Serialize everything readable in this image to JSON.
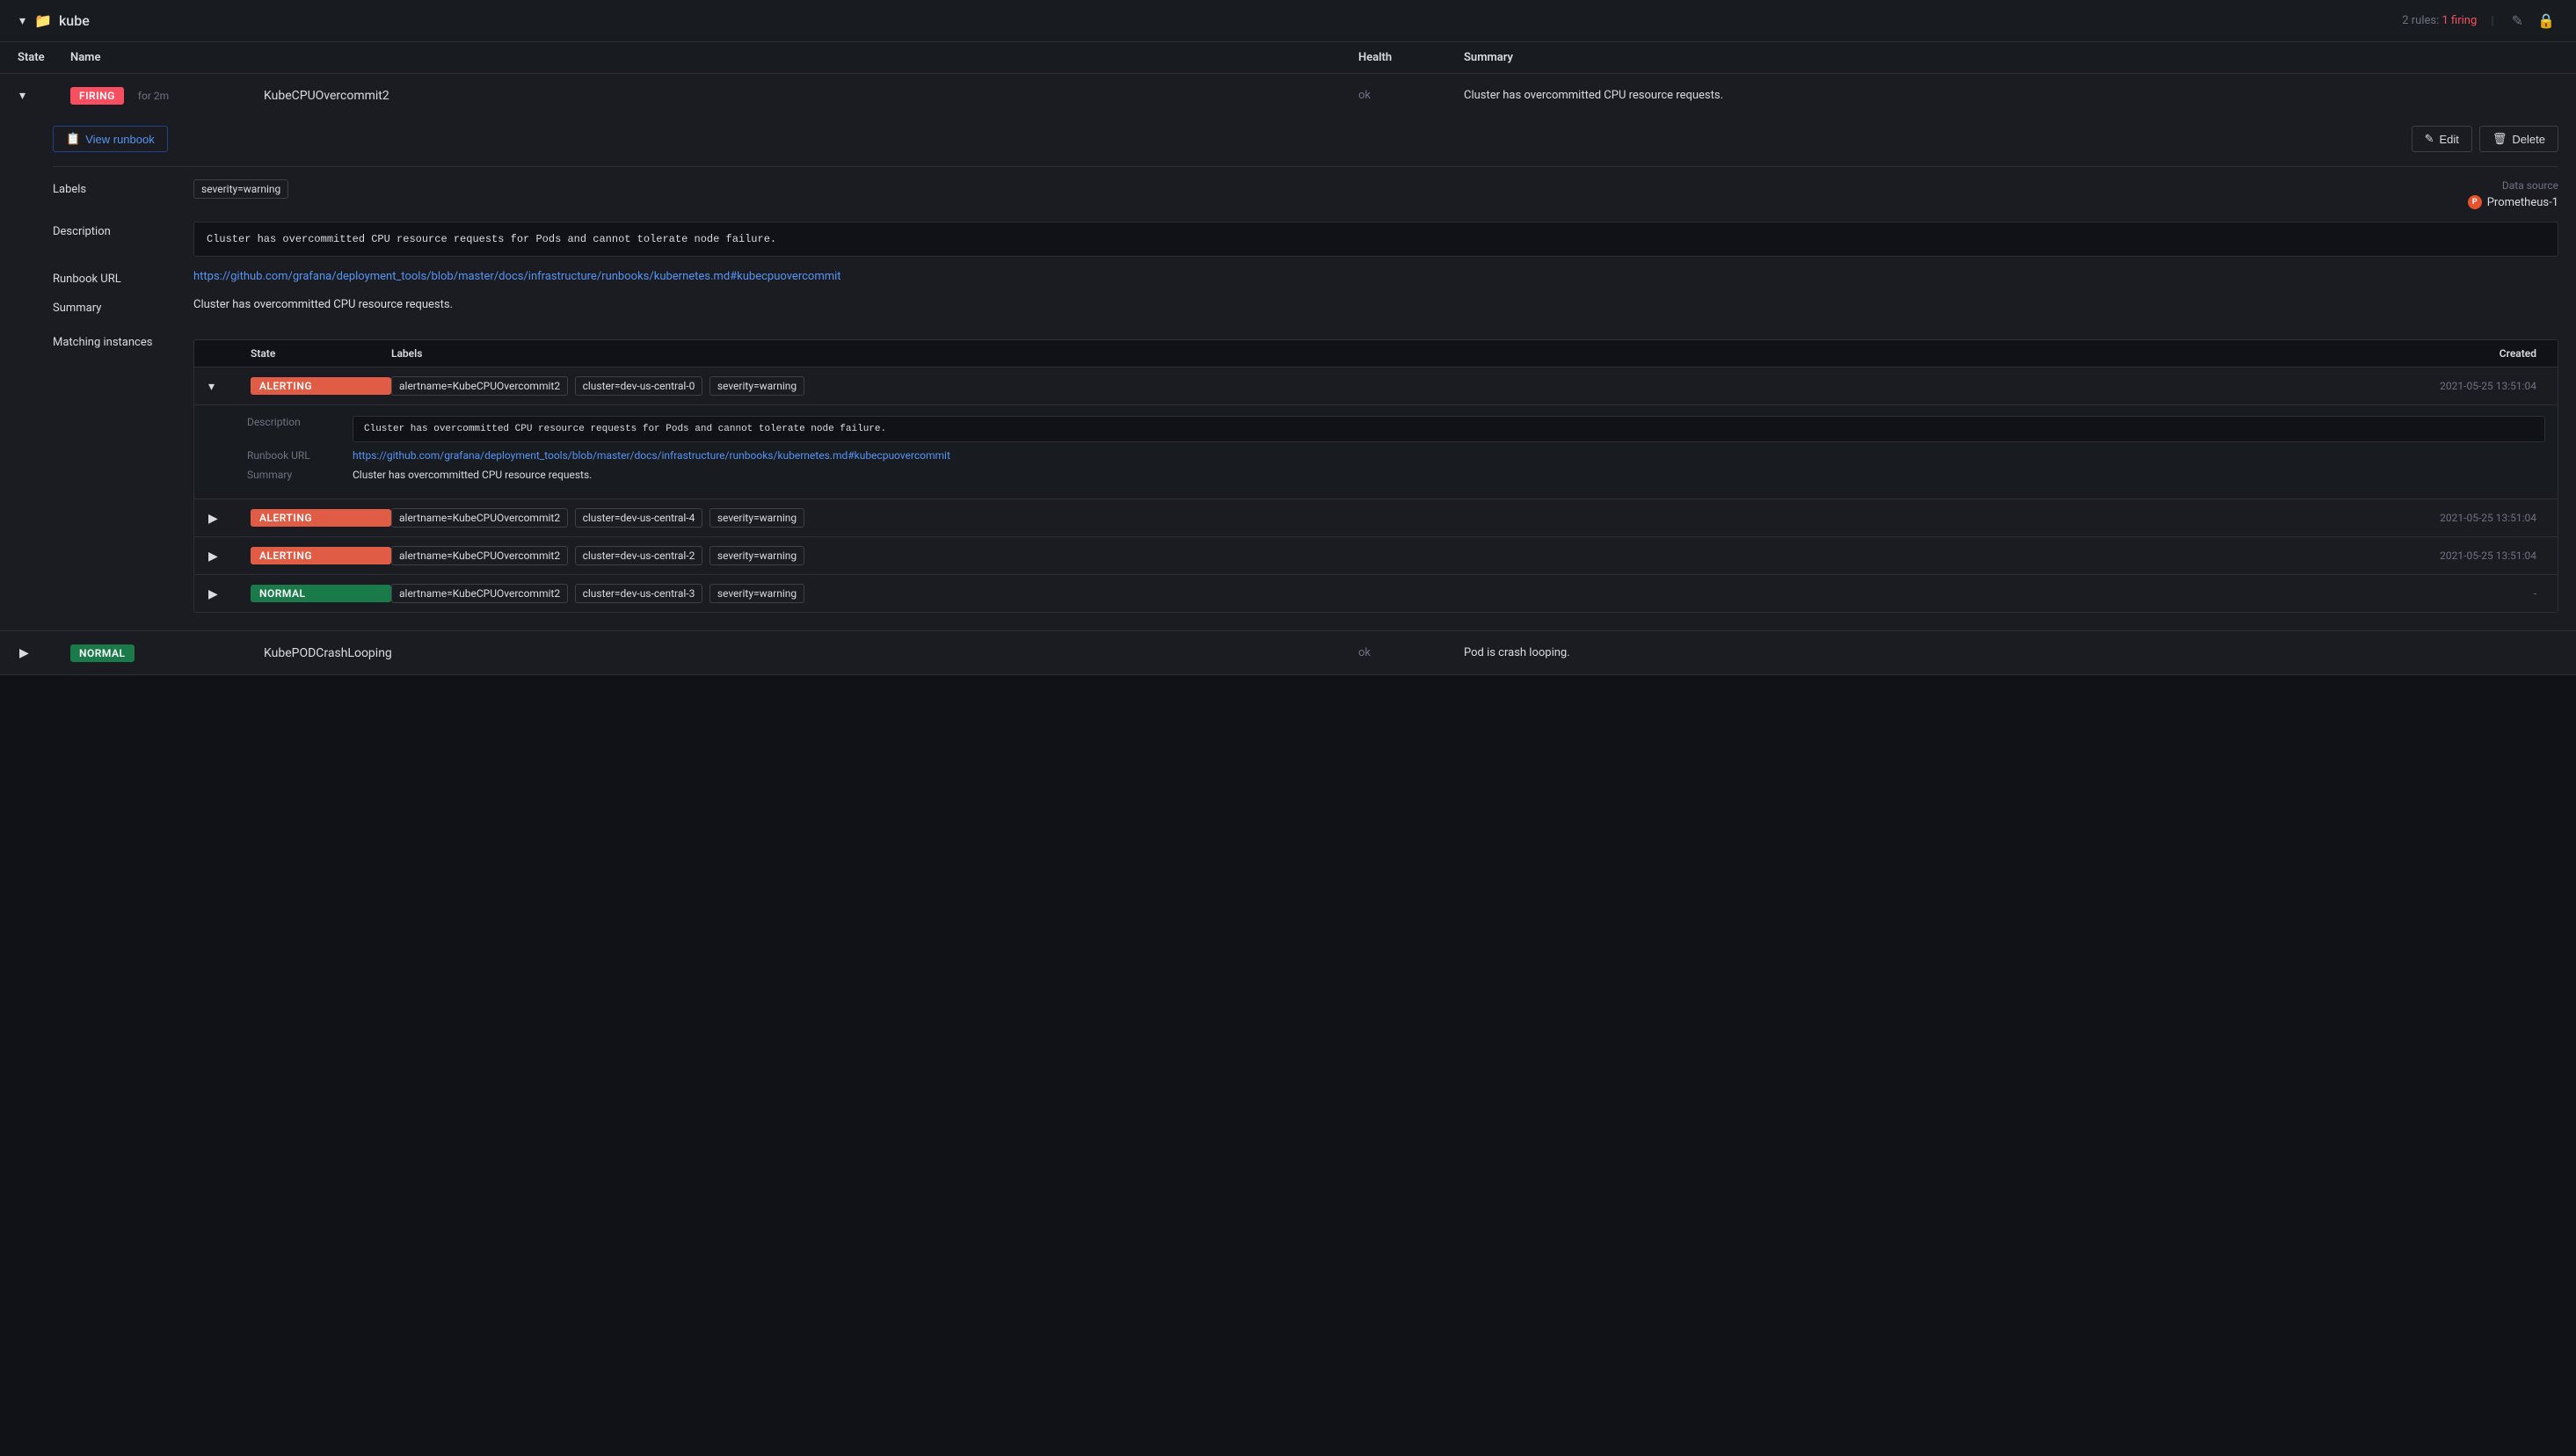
{
  "topbar": {
    "chevron": "▾",
    "folder_icon": "📁",
    "title": "kube",
    "rules_text": "2 rules:",
    "firing_count": "1 firing",
    "divider": "|",
    "edit_icon": "✎",
    "lock_icon": "🔒"
  },
  "table": {
    "headers": {
      "state": "State",
      "name": "Name",
      "health": "Health",
      "summary": "Summary"
    }
  },
  "rule1": {
    "state": "Firing",
    "state_type": "firing",
    "for_duration": "for 2m",
    "name": "KubeCPUOvercommit2",
    "health": "ok",
    "summary": "Cluster has overcommitted CPU resource requests.",
    "view_runbook_label": "View runbook",
    "edit_label": "Edit",
    "delete_label": "Delete",
    "labels_label": "Labels",
    "labels": [
      "severity=warning"
    ],
    "data_source_label": "Data source",
    "data_source_name": "Prometheus-1",
    "description_label": "Description",
    "description": "Cluster has overcommitted CPU resource requests for Pods and cannot tolerate node failure.",
    "runbook_url_label": "Runbook URL",
    "runbook_url": "https://github.com/grafana/deployment_tools/blob/master/docs/infrastructure/runbooks/kubernetes.md#kubecpuovercommit",
    "summary_label": "Summary",
    "summary_detail": "Cluster has overcommitted CPU resource requests.",
    "matching_instances_label": "Matching instances",
    "instances_headers": {
      "state": "State",
      "labels": "Labels",
      "created": "Created"
    },
    "instances": [
      {
        "id": "inst1",
        "state": "Alerting",
        "state_type": "alerting",
        "expanded": true,
        "labels": [
          "alertname=KubeCPUOvercommit2",
          "cluster=dev-us-central-0",
          "severity=warning"
        ],
        "created": "2021-05-25 13:51:04",
        "description": "Cluster has overcommitted CPU resource requests for Pods and cannot tolerate node failure.",
        "runbook_url": "https://github.com/grafana/deployment_tools/blob/master/docs/infrastructure/runbooks/kubernetes.md#kubecpuovercommit",
        "summary": "Cluster has overcommitted CPU resource requests."
      },
      {
        "id": "inst2",
        "state": "Alerting",
        "state_type": "alerting",
        "expanded": false,
        "labels": [
          "alertname=KubeCPUOvercommit2",
          "cluster=dev-us-central-4",
          "severity=warning"
        ],
        "created": "2021-05-25 13:51:04"
      },
      {
        "id": "inst3",
        "state": "Alerting",
        "state_type": "alerting",
        "expanded": false,
        "labels": [
          "alertname=KubeCPUOvercommit2",
          "cluster=dev-us-central-2",
          "severity=warning"
        ],
        "created": "2021-05-25 13:51:04"
      },
      {
        "id": "inst4",
        "state": "Normal",
        "state_type": "normal",
        "expanded": false,
        "labels": [
          "alertname=KubeCPUOvercommit2",
          "cluster=dev-us-central-3",
          "severity=warning"
        ],
        "created": "-"
      }
    ]
  },
  "rule2": {
    "state": "Normal",
    "state_type": "normal",
    "name": "KubePODCrashLooping",
    "health": "ok",
    "summary": "Pod is crash looping."
  }
}
